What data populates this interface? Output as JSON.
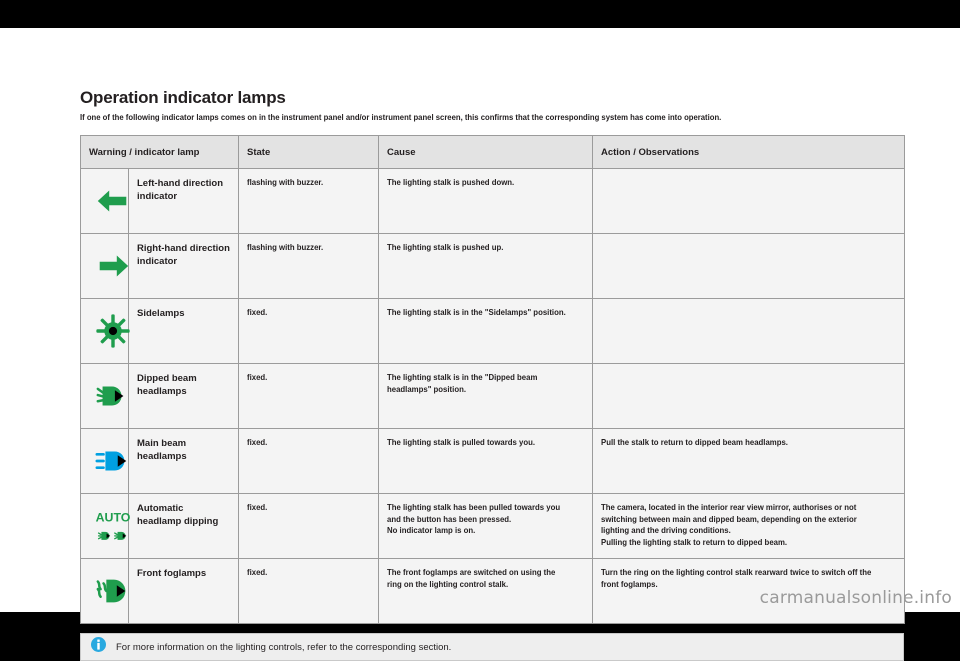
{
  "page": {
    "title": "Operation indicator lamps",
    "subtitle": "If one of the following indicator lamps comes on in the instrument panel and/or instrument panel screen, this confirms that the corresponding system has come into operation.",
    "watermark": "carmanualsonline.info"
  },
  "note": {
    "icon": "info-icon",
    "text": "For more information on the lighting controls, refer to the corresponding section."
  },
  "table": {
    "headers": [
      "Warning / indicator lamp",
      "State",
      "Cause",
      "Action / Observations"
    ],
    "rows": [
      {
        "icon": "left-arrow-icon",
        "icon_color": "#1f9d4d",
        "name": "Left-hand direction indicator",
        "state": "flashing with buzzer.",
        "cause": "The lighting stalk is pushed down.",
        "action": ""
      },
      {
        "icon": "right-arrow-icon",
        "icon_color": "#1f9d4d",
        "name": "Right-hand direction indicator",
        "state": "flashing with buzzer.",
        "cause": "The lighting stalk is pushed up.",
        "action": ""
      },
      {
        "icon": "sidelamps-icon",
        "icon_color": "#1f9d4d",
        "name": "Sidelamps",
        "state": "fixed.",
        "cause": "The lighting stalk is in the \"Sidelamps\" position.",
        "action": ""
      },
      {
        "icon": "dipped-beam-headlamp-icon",
        "icon_color": "#1f9d4d",
        "name": "Dipped beam headlamps",
        "state": "fixed.",
        "cause": "The lighting stalk is in the \"Dipped beam headlamps\" position.",
        "action": ""
      },
      {
        "icon": "main-beam-headlamp-icon",
        "icon_color": "#00a0e1",
        "name": "Main beam headlamps",
        "state": "fixed.",
        "cause": "The lighting stalk is pulled towards you.",
        "action": "Pull the stalk to return to dipped beam headlamps."
      },
      {
        "icon": "auto-headlamp-dipping-icon",
        "icon_color": "#1f9d4d",
        "icon_label": "AUTO",
        "name": "Automatic headlamp dipping",
        "state": "fixed.",
        "cause": "The lighting stalk has been pulled towards you and the button has been pressed.\nNo indicator lamp is on.",
        "action": "The camera, located in the interior rear view mirror, authorises or not switching between main and dipped beam, depending on the exterior lighting and the driving conditions.\nPulling the lighting stalk to return to dipped beam."
      },
      {
        "icon": "front-foglamp-icon",
        "icon_color": "#1f9d4d",
        "name": "Front foglamps",
        "state": "fixed.",
        "cause": "The front foglamps are switched on using the ring on the lighting control stalk.",
        "action": "Turn the ring on the lighting control stalk rearward twice to switch off the front foglamps."
      }
    ]
  }
}
